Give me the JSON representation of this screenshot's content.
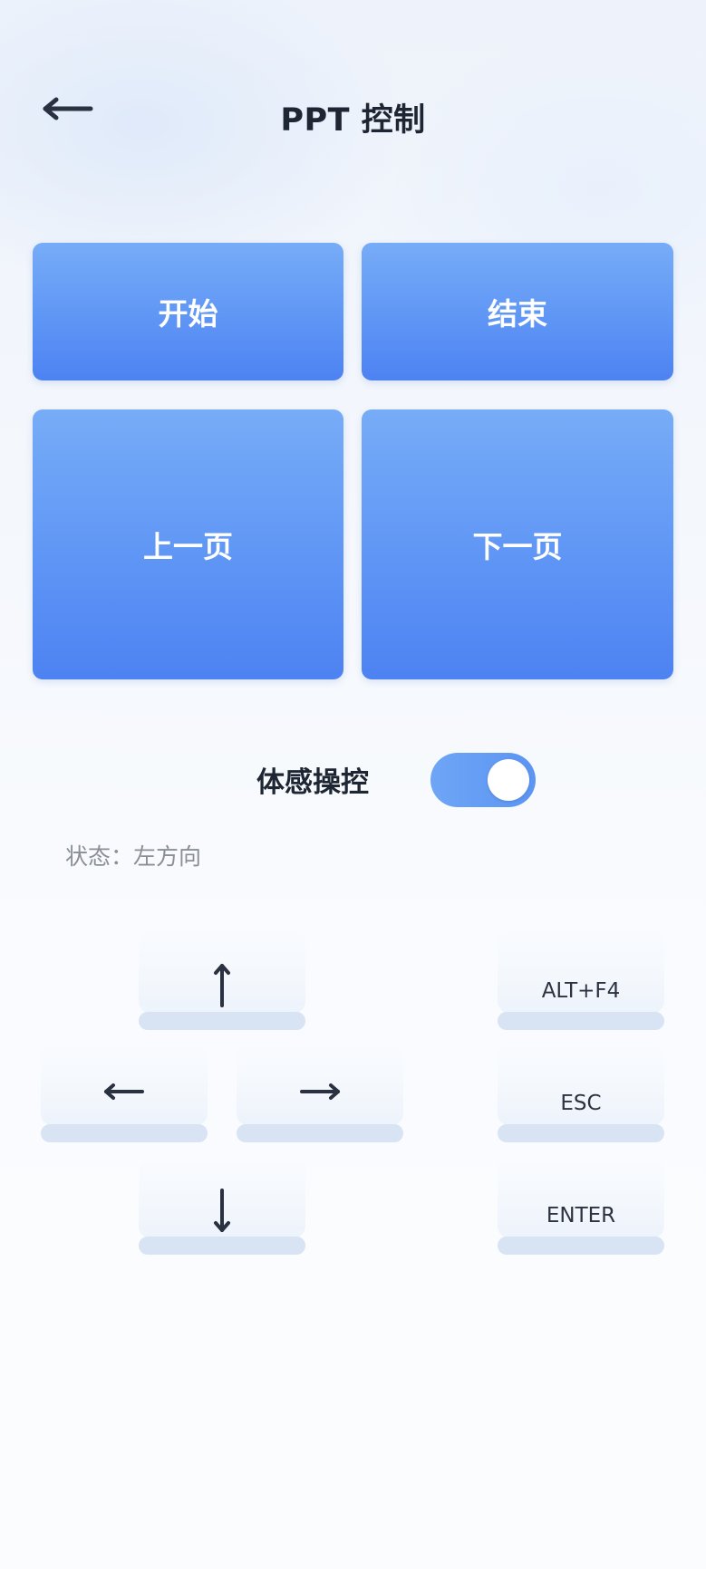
{
  "header": {
    "back_icon": "arrow-left-icon",
    "title": "PPT 控制"
  },
  "controls": {
    "start": "开始",
    "end": "结束",
    "prev": "上一页",
    "next": "下一页"
  },
  "motion": {
    "label": "体感操控",
    "enabled": true,
    "status": "状态：左方向"
  },
  "keys": {
    "up_icon": "arrow-up-icon",
    "left_icon": "arrow-left-icon",
    "right_icon": "arrow-right-icon",
    "down_icon": "arrow-down-icon",
    "alt_f4": "ALT+F4",
    "esc": "ESC",
    "enter": "ENTER"
  },
  "colors": {
    "button_gradient_top": "#77acf7",
    "button_gradient_bottom": "#4d82f2",
    "toggle_on": "#5b95f3",
    "text_dark": "#1f2633",
    "status_text": "#8a8f97",
    "key_base": "#d8e3f3"
  }
}
